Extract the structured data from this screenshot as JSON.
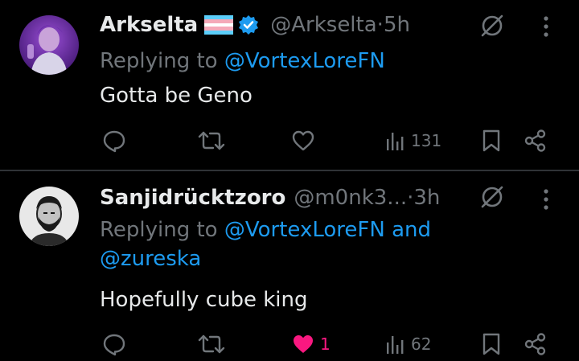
{
  "tweets": [
    {
      "name": "Arkselta",
      "handle": "@Arkselta",
      "dot": " · ",
      "time": "5h",
      "replying_prefix": "Replying to ",
      "mentions": "@VortexLoreFN",
      "mentions_suffix": "",
      "text": "Gotta be Geno",
      "stats": {
        "views": "131",
        "likes": ""
      }
    },
    {
      "name": "Sanjidrücktzoro",
      "handle": "@m0nk3...",
      "dot": " · ",
      "time": "3h",
      "replying_prefix": "Replying to ",
      "mentions": "@VortexLoreFN and",
      "mentions_suffix": "@zureska",
      "text": "Hopefully cube king",
      "stats": {
        "views": "62",
        "likes": "1"
      }
    }
  ],
  "colors": {
    "accent": "#1d9bf0",
    "like": "#f91880",
    "muted": "#71767b",
    "text": "#e7e9ea",
    "background": "#000000",
    "divider": "#2f3336"
  },
  "icons": {
    "reply": "reply-icon",
    "retweet": "retweet-icon",
    "like": "heart-icon",
    "views": "views-icon",
    "bookmark": "bookmark-icon",
    "share": "share-icon",
    "grok": "grok-icon",
    "more": "more-icon",
    "verified": "verified-icon",
    "flag": "trans-flag-icon"
  }
}
